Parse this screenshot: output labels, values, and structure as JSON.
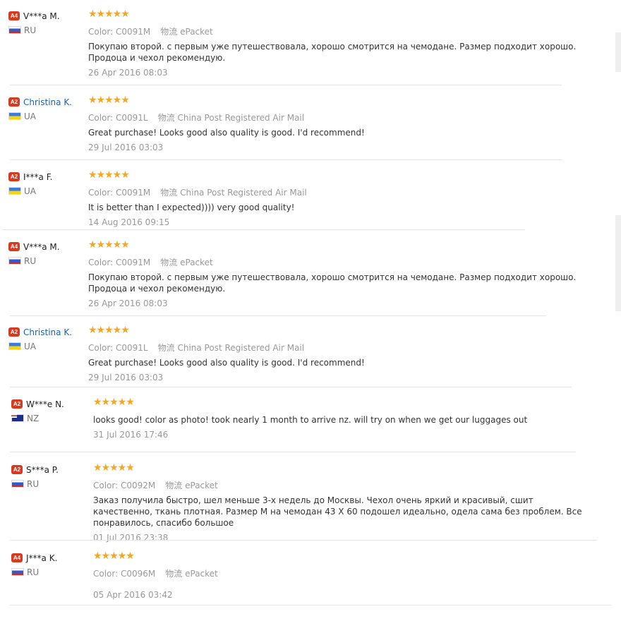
{
  "labels": {
    "color": "Color:",
    "ship": "物流"
  },
  "reviews": [
    {
      "level": "A4",
      "name": "V***a M.",
      "link": false,
      "country": "RU",
      "rating": "★★★★★",
      "color": "C0091M",
      "ship": "ePacket",
      "text": "Покупаю второй. с первым уже путешествовала, хорошо смотрится на чемодане. Размер подходит хорошо. Продоца и чехол рекомендую.",
      "date": "26 Apr 2016 08:03"
    },
    {
      "level": "A2",
      "name": "Christina K.",
      "link": true,
      "country": "UA",
      "rating": "★★★★★",
      "color": "C0091L",
      "ship": "China Post Registered Air Mail",
      "text": "Great purchase! Looks good also quality is good. I'd recommend!",
      "date": "29 Jul 2016 03:03"
    },
    {
      "level": "A2",
      "name": "I***a F.",
      "link": false,
      "country": "UA",
      "rating": "★★★★★",
      "color": "C0091M",
      "ship": "China Post Registered Air Mail",
      "text": "It is better than I expected)))) very good quality!",
      "date": "14 Aug 2016 09:15"
    },
    {
      "level": "A4",
      "name": "V***a M.",
      "link": false,
      "country": "RU",
      "rating": "★★★★★",
      "color": "C0091M",
      "ship": "ePacket",
      "text": "Покупаю второй. с первым уже путешествовала, хорошо смотрится на чемодане. Размер подходит хорошо. Продоца и чехол рекомендую.",
      "date": "26 Apr 2016 08:03"
    },
    {
      "level": "A2",
      "name": "Christina K.",
      "link": true,
      "country": "UA",
      "rating": "★★★★★",
      "color": "C0091L",
      "ship": "China Post Registered Air Mail",
      "text": "Great purchase! Looks good also quality is good. I'd recommend!",
      "date": "29 Jul 2016 03:03"
    },
    {
      "level": "A2",
      "name": "W***e N.",
      "link": false,
      "country": "NZ",
      "rating": "★★★★★",
      "color": null,
      "ship": null,
      "text": "looks good! color as photo! took nearly 1 month to arrive nz. will try on when we get our luggages out",
      "date": "31 Jul 2016 17:46"
    },
    {
      "level": "A2",
      "name": "S***a P.",
      "link": false,
      "country": "RU",
      "rating": "★★★★★",
      "color": "C0092M",
      "ship": "ePacket",
      "text": "Заказ получила быстро, шел меньше 3-х недель до Москвы. Чехол очень яркий и красивый, сшит качественно, ткань плотная. Размер M на чемодан 43 X 60 подошел идеально, одела сама без проблем. Все понравилось, спасибо большое",
      "date": "01 Jul 2016 23:38"
    },
    {
      "level": "A4",
      "name": "J***a K.",
      "link": false,
      "country": "RU",
      "rating": "★★★★★",
      "color": "C0096M",
      "ship": "ePacket",
      "text": "",
      "date": "05 Apr 2016 03:42"
    }
  ]
}
